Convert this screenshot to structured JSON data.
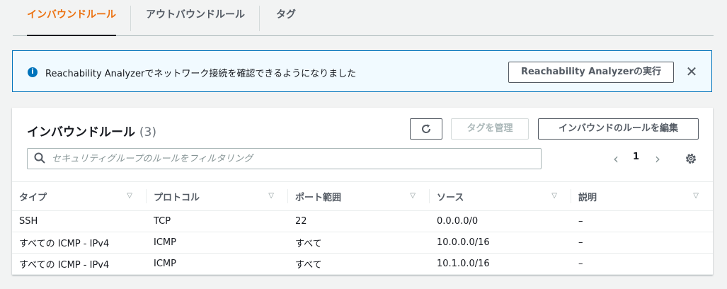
{
  "tabs": [
    {
      "label": "インバウンドルール"
    },
    {
      "label": "アウトバウンドルール"
    },
    {
      "label": "タグ"
    }
  ],
  "flash": {
    "icon": "info-icon",
    "message": "Reachability Analyzerでネットワーク接続を確認できるようになりました",
    "action_label": "Reachability Analyzerの実行",
    "close_label": "✕"
  },
  "panel": {
    "title": "インバウンドルール",
    "count": "(3)",
    "manage_tags_label": "タグを管理",
    "edit_rules_label": "インバウンドのルールを編集",
    "search_placeholder": "セキュリティグループのルールをフィルタリング",
    "page_number": "1"
  },
  "table": {
    "columns": [
      "タイプ",
      "プロトコル",
      "ポート範囲",
      "ソース",
      "説明"
    ],
    "rows": [
      [
        "SSH",
        "TCP",
        "22",
        "0.0.0.0/0",
        "–"
      ],
      [
        "すべての ICMP - IPv4",
        "ICMP",
        "すべて",
        "10.0.0.0/16",
        "–"
      ],
      [
        "すべての ICMP - IPv4",
        "ICMP",
        "すべて",
        "10.1.0.0/16",
        "–"
      ]
    ]
  }
}
